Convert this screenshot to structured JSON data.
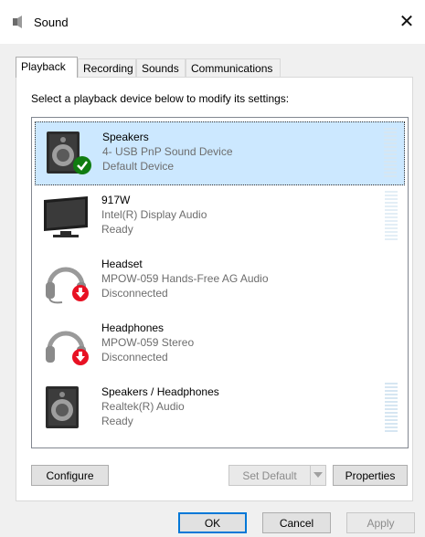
{
  "window": {
    "title": "Sound",
    "close_glyph": "✕",
    "icon": "speaker-icon"
  },
  "tabs": [
    {
      "label": "Playback",
      "active": true
    },
    {
      "label": "Recording",
      "active": false
    },
    {
      "label": "Sounds",
      "active": false
    },
    {
      "label": "Communications",
      "active": false
    }
  ],
  "instruction": "Select a playback device below to modify its settings:",
  "devices": [
    {
      "name": "Speakers",
      "detail": "4- USB PnP Sound Device",
      "status": "Default Device",
      "icon": "speaker-icon",
      "badge": "default-check-icon",
      "selected": true,
      "meter": true
    },
    {
      "name": "917W",
      "detail": "Intel(R) Display Audio",
      "status": "Ready",
      "icon": "monitor-icon",
      "badge": "",
      "selected": false,
      "meter": true
    },
    {
      "name": "Headset",
      "detail": "MPOW-059 Hands-Free AG Audio",
      "status": "Disconnected",
      "icon": "headset-icon",
      "badge": "disconnected-arrow-icon",
      "selected": false,
      "meter": false
    },
    {
      "name": "Headphones",
      "detail": "MPOW-059 Stereo",
      "status": "Disconnected",
      "icon": "headphones-icon",
      "badge": "disconnected-arrow-icon",
      "selected": false,
      "meter": false
    },
    {
      "name": "Speakers / Headphones",
      "detail": "Realtek(R) Audio",
      "status": "Ready",
      "icon": "speaker-icon",
      "badge": "",
      "selected": false,
      "meter": true
    }
  ],
  "buttons": {
    "configure": "Configure",
    "set_default": "Set Default",
    "properties": "Properties",
    "ok": "OK",
    "cancel": "Cancel",
    "apply": "Apply"
  },
  "colors": {
    "selection": "#cce8ff",
    "check_green": "#107c10",
    "disconnect_red": "#e81123",
    "accent": "#0078d7"
  }
}
